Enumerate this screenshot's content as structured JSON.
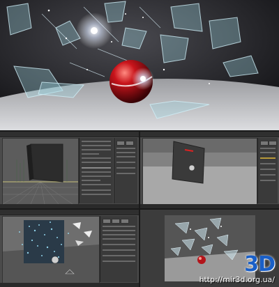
{
  "colors": {
    "ball": "#b3141a",
    "glass": "#9fd3e0",
    "viewport_bg": "#5a5a5a",
    "ui_panel": "#3a3a3a",
    "watermark_blue": "#1a5fc7"
  },
  "watermark": {
    "brand": "3D",
    "url": "http://mir3d.org.ua/"
  },
  "panels": [
    {
      "name": "viewport-front-wall-grid"
    },
    {
      "name": "viewport-perspective-ball-wall"
    },
    {
      "name": "viewport-shattering-particles"
    },
    {
      "name": "viewport-render-result"
    }
  ]
}
